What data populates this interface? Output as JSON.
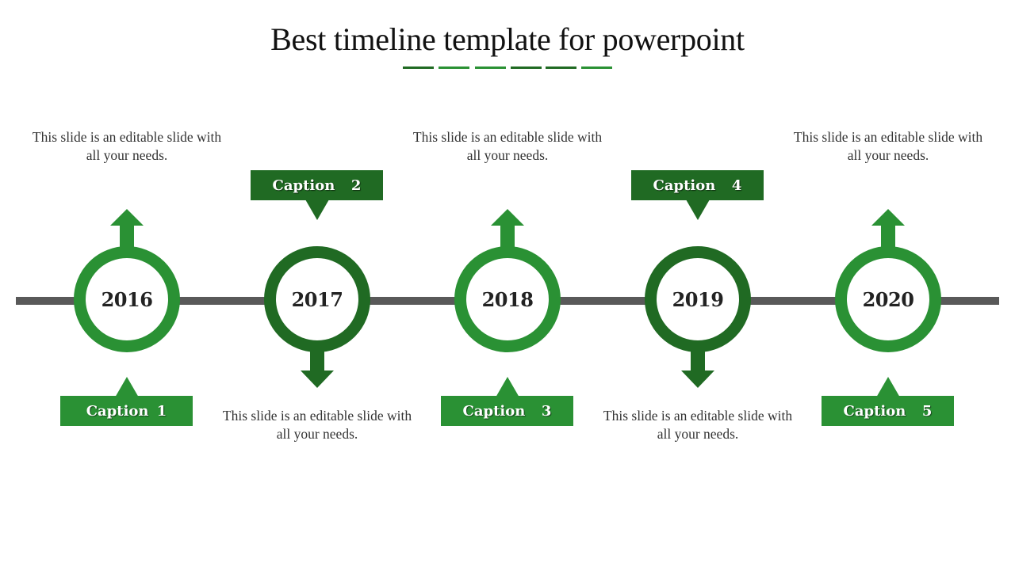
{
  "slide": {
    "title": "Best timeline template for powerpoint",
    "colors": {
      "light_green": "#2A9134",
      "dark_green": "#206A23",
      "line_gray": "#595959",
      "year_text": "#222222"
    },
    "title_underline": [
      "#206A23",
      "#2A9134",
      "#2A9134",
      "#206A23",
      "#206A23",
      "#2A9134"
    ],
    "milestones": [
      {
        "year": "2016",
        "caption": "Caption 1",
        "description": "This slide is an editable slide with all your needs.",
        "tone": "light",
        "arrow": "up",
        "caption_position": "bottom",
        "description_position": "top"
      },
      {
        "year": "2017",
        "caption": "Caption  2",
        "description": "This slide is an editable slide with all your needs.",
        "tone": "dark",
        "arrow": "down",
        "caption_position": "top",
        "description_position": "bottom"
      },
      {
        "year": "2018",
        "caption": "Caption  3",
        "description": "This slide is an editable slide with all your needs.",
        "tone": "light",
        "arrow": "up",
        "caption_position": "bottom",
        "description_position": "top"
      },
      {
        "year": "2019",
        "caption": "Caption  4",
        "description": "This slide is an editable slide with all your needs.",
        "tone": "dark",
        "arrow": "down",
        "caption_position": "top",
        "description_position": "bottom"
      },
      {
        "year": "2020",
        "caption": "Caption  5",
        "description": "This slide is an editable slide with all your needs.",
        "tone": "light",
        "arrow": "up",
        "caption_position": "bottom",
        "description_position": "top"
      }
    ]
  }
}
